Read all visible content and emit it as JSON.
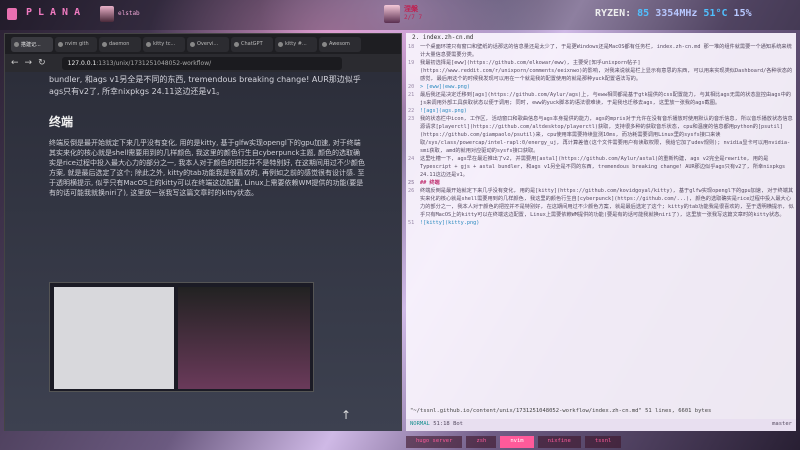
{
  "topbar": {
    "workspace_label": "PLANA",
    "client_title": "elstab",
    "media_title": "涅槃",
    "media_time": "2/7 7",
    "cpu_label": "RYZEN:",
    "cpu_pct": "85",
    "cpu_freq": "3354MHz",
    "cpu_temp": "51°C",
    "mem": "15%"
  },
  "browser": {
    "tabs": [
      "搭建记...",
      "nvim gith",
      "daemon",
      "kitty tc...",
      "Overvi...",
      "ChatGPT",
      "kitty #...",
      "Awesom"
    ],
    "url_prefix": "127.0.0.1",
    "url_rest": ":1313/unix/1731251048052-workflow/",
    "page": {
      "p1": "bundler, 和ags v1另全是不同的东西, tremendous breaking change! AUR那边似乎ags只有v2了, 所幸nixpkgs 24.11这边还是v1。",
      "h2": "终端",
      "p2": "终端反倒是最开始就定下来几乎没有变化, 用的是kitty, 基于glfw实现opengl下的gpu加速, 对于终端其实来化的核心就是shell需要用到的几样颜色, 我这里的颜色行生自cyberpunck主题, 颜色的选取确实是rice过程中投入最大心力的部分之一, 我本人对于颜色的把控并不是特别好, 在这期间用过不少颜色方案, 就是最后选定了这个; 除此之外, kitty的tab功能我是很喜欢的, 再例如之前的感觉很有设计感. 至于透明横提示, 似乎只有MacOS上的kitty可以在终端这边配置, Linux上需要依赖WM提供的功能(要是有的话可能我就换niri了), 这里放一张我写这篇文章时的kitty状态。"
    }
  },
  "editor": {
    "tab": "2. index.zh-cn.md",
    "lines": [
      {
        "n": "18",
        "t": "一个桌面环境只有窗口和壁纸的话那这的信息量还是太少了, 于是更Windows还是MacOS都有任务栏, index.zh-cn.md 那一堆的组件就需要一个通知系统来统计大量信息要需要分类。",
        "c": ""
      },
      {
        "n": "",
        "t": "",
        "c": ""
      },
      {
        "n": "19",
        "t": "我最初选择是[eww](https://github.com/elkowar/eww), 主要受[知乎unixporn帖子](https://www.reddit.com/r/unixporn/comments/eeixnwo)的影响, 对我来说就是栏上显示有意思的东西, 可以用来实现类似Dashboard/各种状态的感觉, 最后用这个的时候我发现可以用在一个就是我的配置使用的就是那种yuck配置语法写的。",
        "c": ""
      },
      {
        "n": "",
        "t": "",
        "c": ""
      },
      {
        "n": "20",
        "t": "> [eww](eww.png)",
        "c": "lk"
      },
      {
        "n": "",
        "t": "",
        "c": ""
      },
      {
        "n": "21",
        "t": "最后我还是决定迁移到[ags](https://github.com/Aylur/ags)上, 与eww相同都是基于gtk提供的css配置能力, 与其相比ags无需的状态监控由ags中的js来调用外部工具获取状态以便于调用; 同时, eww的yuck脚本的语法很难读, 于是我也迁移去ags, 这里放一张我的ags截图。",
        "c": ""
      },
      {
        "n": "",
        "t": "",
        "c": ""
      },
      {
        "n": "22",
        "t": "![ags](ags.png)",
        "c": "lk"
      },
      {
        "n": "",
        "t": "",
        "c": ""
      },
      {
        "n": "23",
        "t": "我的状态栏中icon, 工作区, 活动窗口和歌曲信息与ags本身提供的能力, ags的mpris对于允许在没有音乐播放时使用默认的音乐信息, 所以音乐播放状态信息源请求[playerctl](https://github.com/altdesktop/playerctl)获取, 支持很多种的获取音乐状态, cpu和温度的信息都用python的[psutil](https://github.com/giampaolo/psutil)来, cpu使用率需要持续监测10ms, 而功耗需要调用Linux里的sysfs接口来读取/sys/class/powercap/intel-rapl:0/energy_uj, 再计算差值(这个文件需要用户有读取权限, 我给它加了udev规则); nvidia显卡可以用nvidia-smi获取, amd的就用对应驱动的sysfs接口获取。",
        "c": ""
      },
      {
        "n": "",
        "t": "",
        "c": ""
      },
      {
        "n": "24",
        "t": "这里吐槽一下, ags早在最近推出了v2, 并需要用[astal](https://github.com/Aylur/astal)的重新构建, ags v2完全是rewrite, 用的是Typescript + gjs + astal bundler, 和ags v1另全是不同的东西, tremendous breaking change! AUR那边似乎ags只有v2了, 所幸nixpkgs 24.11这边还是v1。",
        "c": ""
      },
      {
        "n": "",
        "t": "",
        "c": ""
      },
      {
        "n": "25",
        "t": "## 终端",
        "c": "hd"
      },
      {
        "n": "",
        "t": "",
        "c": ""
      },
      {
        "n": "26",
        "t": "终端反倒是最开始就定下来几乎没有变化, 用的是[kitty](https://github.com/kovidgoyal/kitty), 基于glfw实现opengl下的gpu加速, 对于终端其实来化的核心就是shell需要用到的几样颜色, 我这里的颜色行生自[cyberpunck](https://github.com/...), 颜色的选取确实是rice过程中投入最大心力的部分之一, 我本人对于颜色的把控并不是特别好, 在这期间用过不少颜色方案, 就是最后选定了这个; kitty的tab功能我是很喜欢的, 至于透明横提示, 似乎只有MacOS上的kitty可以在终端这边配置, Linux上需要依赖WM提供的功能(要是有的话可能我就换niri了), 这里放一张我写这篇文章时的kitty状态。",
        "c": ""
      },
      {
        "n": "",
        "t": "",
        "c": ""
      },
      {
        "n": "51",
        "t": "![kitty](kitty.png)",
        "c": "lk"
      }
    ],
    "mode": "NORMAL",
    "position": "51:18",
    "scroll": "Bot",
    "branch": "master",
    "cmd": "\"~/tssnl.github.io/content/unix/1731251048052-workflow/index.zh-cn.md\" 51 lines, 6601 bytes"
  },
  "kitty_tabs": [
    "hugo server",
    "zsh",
    "nvim",
    "nixfine",
    "tssnl"
  ]
}
